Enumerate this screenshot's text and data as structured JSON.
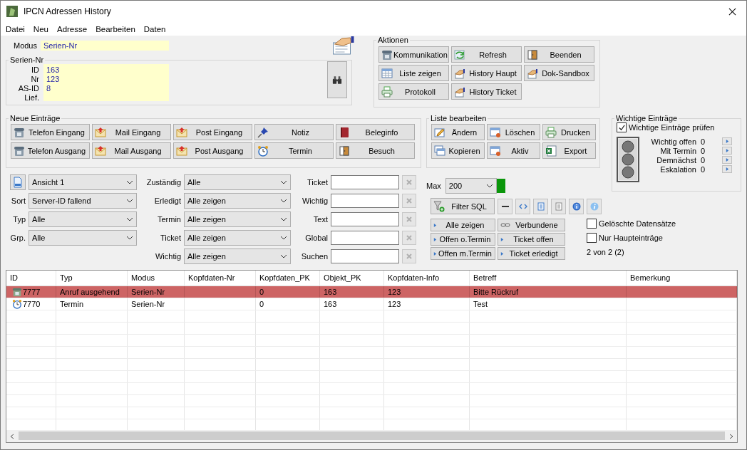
{
  "window": {
    "title": "IPCN Adressen History"
  },
  "menu": [
    "Datei",
    "Neu",
    "Adresse",
    "Bearbeiten",
    "Daten"
  ],
  "modus": {
    "label": "Modus",
    "value": "Serien-Nr"
  },
  "serien_nr": {
    "title": "Serien-Nr",
    "fields": [
      {
        "label": "ID",
        "value": "163"
      },
      {
        "label": "Nr",
        "value": "123"
      },
      {
        "label": "AS-ID",
        "value": "8"
      },
      {
        "label": "Lief."
      }
    ]
  },
  "aktionen": {
    "title": "Aktionen",
    "buttons": [
      "Kommunikation",
      "Refresh",
      "Beenden",
      "Liste zeigen",
      "History Haupt",
      "Dok-Sandbox",
      "Protokoll",
      "History Ticket"
    ]
  },
  "neue_eintraege": {
    "title": "Neue Einträge",
    "buttons": [
      "Telefon Eingang",
      "Mail Eingang",
      "Post Eingang",
      "Notiz",
      "Beleginfo",
      "Telefon Ausgang",
      "Mail Ausgang",
      "Post Ausgang",
      "Termin",
      "Besuch"
    ]
  },
  "liste_bearbeiten": {
    "title": "Liste bearbeiten",
    "buttons": [
      "Ändern",
      "Löschen",
      "Drucken",
      "Kopieren",
      "Aktiv",
      "Export"
    ]
  },
  "wichtige_eintraege": {
    "title": "Wichtige Einträge",
    "check": {
      "label": "Wichtige Einträge prüfen",
      "checked": true
    },
    "counters": [
      {
        "label": "Wichtig offen",
        "value": "0"
      },
      {
        "label": "Mit Termin",
        "value": "0"
      },
      {
        "label": "Demnächst",
        "value": "0"
      },
      {
        "label": "Eskalation",
        "value": "0"
      }
    ]
  },
  "filters_left": [
    {
      "value": "Ansicht 1"
    },
    {
      "label": "Sort",
      "value": "Server-ID fallend"
    },
    {
      "label": "Typ",
      "value": "Alle"
    },
    {
      "label": "Grp.",
      "value": "Alle"
    }
  ],
  "filters_middle": [
    {
      "label": "Zuständig",
      "value": "Alle"
    },
    {
      "label": "Erledigt",
      "value": "Alle zeigen"
    },
    {
      "label": "Termin",
      "value": "Alle zeigen"
    },
    {
      "label": "Ticket",
      "value": "Alle zeigen"
    },
    {
      "label": "Wichtig",
      "value": "Alle zeigen"
    }
  ],
  "filters_text": [
    {
      "label": "Ticket",
      "clear_disabled": true
    },
    {
      "label": "Wichtig",
      "clear_disabled": true
    },
    {
      "label": "Text",
      "clear_disabled": true
    },
    {
      "label": "Global",
      "clear_disabled": true
    },
    {
      "label": "Suchen",
      "clear_disabled": true
    }
  ],
  "max": {
    "label": "Max",
    "value": "200"
  },
  "filter_sql": "Filter SQL",
  "quick_buttons": [
    "Alle zeigen",
    "Verbundene",
    "Offen o.Termin",
    "Ticket offen",
    "Offen m.Termin",
    "Ticket erledigt"
  ],
  "options": [
    {
      "label": "Gelöschte Datensätze",
      "checked": false
    },
    {
      "label": "Nur Haupteinträge",
      "checked": false
    }
  ],
  "count": "2 von 2 (2)",
  "table": {
    "columns": [
      "ID",
      "Typ",
      "Modus",
      "Kopfdaten-Nr",
      "Kopfdaten_PK",
      "Objekt_PK",
      "Kopfdaten-Info",
      "Betreff",
      "Bemerkung"
    ],
    "rows": [
      {
        "kind": "phone",
        "selected": true,
        "cells": [
          "7777",
          "Anruf ausgehend",
          "Serien-Nr",
          null,
          "0",
          "163",
          "123",
          "Bitte Rückruf",
          null
        ]
      },
      {
        "kind": "clock",
        "selected": false,
        "cells": [
          "7770",
          "Termin",
          "Serien-Nr",
          null,
          "0",
          "163",
          "123",
          "Test",
          null
        ]
      }
    ]
  }
}
